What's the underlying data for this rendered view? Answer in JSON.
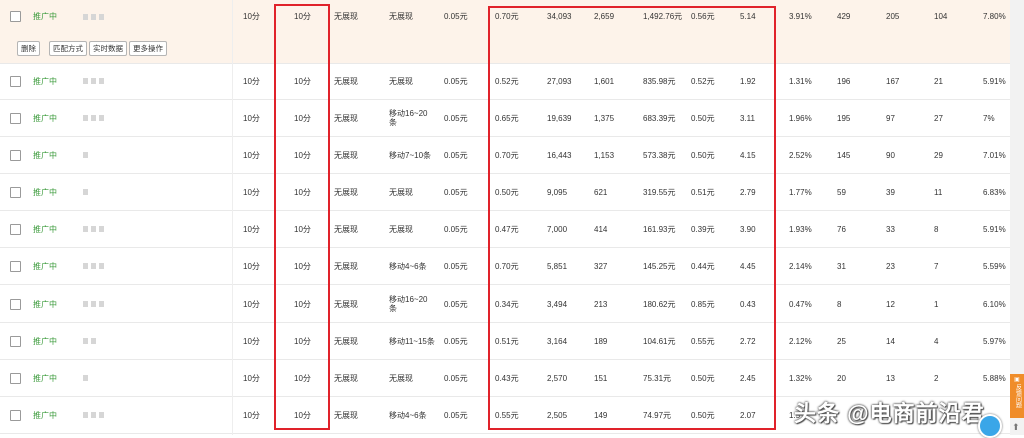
{
  "action_buttons": [
    "删除",
    "匹配方式",
    "实时数据",
    "更多操作"
  ],
  "rows": [
    {
      "status": "推广中",
      "dots": 3,
      "c1": "10分",
      "c2": "10分",
      "c3": "无展现",
      "c4": "无展现",
      "c5": "0.05元",
      "c6": "0.70元",
      "c7": "34,093",
      "c8": "2,659",
      "c9": "1,492.76元",
      "c10": "0.56元",
      "c11": "5.14",
      "c12": "3.91%",
      "c13": "429",
      "c14": "205",
      "c15": "104",
      "c16": "7.80%"
    },
    {
      "status": "推广中",
      "dots": 3,
      "c1": "10分",
      "c2": "10分",
      "c3": "无展现",
      "c4": "无展现",
      "c5": "0.05元",
      "c6": "0.52元",
      "c7": "27,093",
      "c8": "1,601",
      "c9": "835.98元",
      "c10": "0.52元",
      "c11": "1.92",
      "c12": "1.31%",
      "c13": "196",
      "c14": "167",
      "c15": "21",
      "c16": "5.91%"
    },
    {
      "status": "推广中",
      "dots": 3,
      "c1": "10分",
      "c2": "10分",
      "c3": "无展现",
      "c4": "移动16~20条",
      "c5": "0.05元",
      "c6": "0.65元",
      "c7": "19,639",
      "c8": "1,375",
      "c9": "683.39元",
      "c10": "0.50元",
      "c11": "3.11",
      "c12": "1.96%",
      "c13": "195",
      "c14": "97",
      "c15": "27",
      "c16": "7%"
    },
    {
      "status": "推广中",
      "dots": 1,
      "c1": "10分",
      "c2": "10分",
      "c3": "无展现",
      "c4": "移动7~10条",
      "c5": "0.05元",
      "c6": "0.70元",
      "c7": "16,443",
      "c8": "1,153",
      "c9": "573.38元",
      "c10": "0.50元",
      "c11": "4.15",
      "c12": "2.52%",
      "c13": "145",
      "c14": "90",
      "c15": "29",
      "c16": "7.01%"
    },
    {
      "status": "推广中",
      "dots": 1,
      "c1": "10分",
      "c2": "10分",
      "c3": "无展现",
      "c4": "无展现",
      "c5": "0.05元",
      "c6": "0.50元",
      "c7": "9,095",
      "c8": "621",
      "c9": "319.55元",
      "c10": "0.51元",
      "c11": "2.79",
      "c12": "1.77%",
      "c13": "59",
      "c14": "39",
      "c15": "11",
      "c16": "6.83%"
    },
    {
      "status": "推广中",
      "dots": 3,
      "c1": "10分",
      "c2": "10分",
      "c3": "无展现",
      "c4": "无展现",
      "c5": "0.05元",
      "c6": "0.47元",
      "c7": "7,000",
      "c8": "414",
      "c9": "161.93元",
      "c10": "0.39元",
      "c11": "3.90",
      "c12": "1.93%",
      "c13": "76",
      "c14": "33",
      "c15": "8",
      "c16": "5.91%"
    },
    {
      "status": "推广中",
      "dots": 3,
      "c1": "10分",
      "c2": "10分",
      "c3": "无展现",
      "c4": "移动4~6条",
      "c5": "0.05元",
      "c6": "0.70元",
      "c7": "5,851",
      "c8": "327",
      "c9": "145.25元",
      "c10": "0.44元",
      "c11": "4.45",
      "c12": "2.14%",
      "c13": "31",
      "c14": "23",
      "c15": "7",
      "c16": "5.59%"
    },
    {
      "status": "推广中",
      "dots": 3,
      "c1": "10分",
      "c2": "10分",
      "c3": "无展现",
      "c4": "移动16~20条",
      "c5": "0.05元",
      "c6": "0.34元",
      "c7": "3,494",
      "c8": "213",
      "c9": "180.62元",
      "c10": "0.85元",
      "c11": "0.43",
      "c12": "0.47%",
      "c13": "8",
      "c14": "12",
      "c15": "1",
      "c16": "6.10%"
    },
    {
      "status": "推广中",
      "dots": 2,
      "c1": "10分",
      "c2": "10分",
      "c3": "无展现",
      "c4": "移动11~15条",
      "c5": "0.05元",
      "c6": "0.51元",
      "c7": "3,164",
      "c8": "189",
      "c9": "104.61元",
      "c10": "0.55元",
      "c11": "2.72",
      "c12": "2.12%",
      "c13": "25",
      "c14": "14",
      "c15": "4",
      "c16": "5.97%"
    },
    {
      "status": "推广中",
      "dots": 1,
      "c1": "10分",
      "c2": "10分",
      "c3": "无展现",
      "c4": "无展现",
      "c5": "0.05元",
      "c6": "0.43元",
      "c7": "2,570",
      "c8": "151",
      "c9": "75.31元",
      "c10": "0.50元",
      "c11": "2.45",
      "c12": "1.32%",
      "c13": "20",
      "c14": "13",
      "c15": "2",
      "c16": "5.88%"
    },
    {
      "status": "推广中",
      "dots": 3,
      "c1": "10分",
      "c2": "10分",
      "c3": "无展现",
      "c4": "移动4~6条",
      "c5": "0.05元",
      "c6": "0.55元",
      "c7": "2,505",
      "c8": "149",
      "c9": "74.97元",
      "c10": "0.50元",
      "c11": "2.07",
      "c12": "1.5",
      "c13": "",
      "c14": "",
      "c15": "",
      "c16": ""
    }
  ],
  "sidebar": {
    "tab_label": "反馈问题"
  },
  "watermark": "头条 @电商前沿君",
  "colors": {
    "highlight_box": "#e0222a",
    "status_green": "#3a9a3a",
    "row_highlight": "#fdf3ea",
    "sidebar_tab": "#f08d2a"
  }
}
